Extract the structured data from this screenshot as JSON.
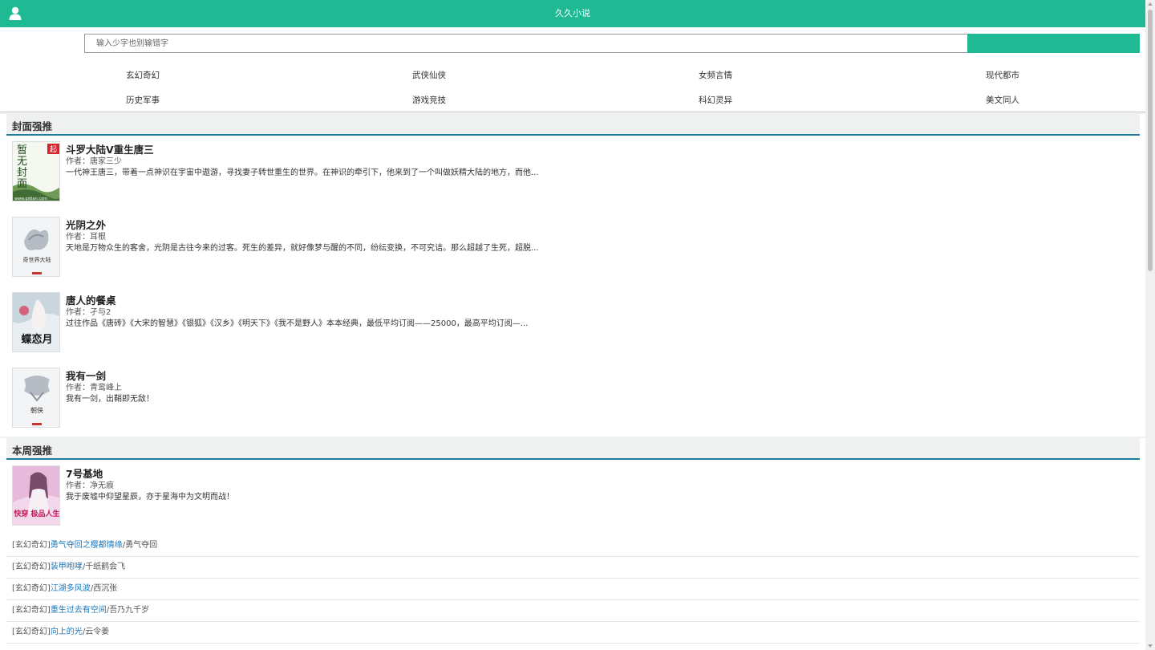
{
  "header": {
    "title": "久久小说",
    "icon": "user-icon"
  },
  "search": {
    "placeholder": "输入少字也别输错字"
  },
  "categories": [
    "玄幻奇幻",
    "武侠仙侠",
    "女频言情",
    "现代都市",
    "历史军事",
    "游戏竞技",
    "科幻灵异",
    "美文同人"
  ],
  "sections": {
    "cover": {
      "title": "封面强推"
    },
    "weekly": {
      "title": "本周强推"
    }
  },
  "cover_books": [
    {
      "name": "斗罗大陆V重生唐三",
      "author": "作者：唐家三少",
      "desc": "一代神王唐三，带着一点神识在宇宙中遨游，寻找妻子转世重生的世界。在神识的牵引下，他来到了一个叫做妖精大陆的地方，而他...",
      "cover_text": "暂无封面",
      "cover_badge": "起",
      "cover_url": "www.qidian.com"
    },
    {
      "name": "光阴之外",
      "author": "作者：耳根",
      "desc": "天地是万物众生的客舍，光阴是古往今来的过客。死生的差异，就好像梦与醒的不同，纷纭变换，不可究诘。那么超越了生死，超脱...",
      "cover_text": "奇世界大陆"
    },
    {
      "name": "唐人的餐桌",
      "author": "作者：孑与2",
      "desc": "过往作品《唐砖》《大宋的智慧》《银狐》《汉乡》《明天下》《我不是野人》本本经典，最低平均订阅——25000，最高平均订阅—...",
      "cover_text": "蝶恋月"
    },
    {
      "name": "我有一剑",
      "author": "作者：青鸾峰上",
      "desc": "我有一剑，出鞘即无敌！",
      "cover_text": "朝侠"
    }
  ],
  "weekly_book": {
    "name": "7号基地",
    "author": "作者：净无痕",
    "desc": "我于废墟中仰望星辰，亦于星海中为文明而战！",
    "cover_text": "快穿 极品人生"
  },
  "weekly_list": [
    {
      "genre": "[玄幻奇幻]",
      "book": "勇气夺回之樱都情缘",
      "sep": "/",
      "author": "勇气夺回"
    },
    {
      "genre": "[玄幻奇幻]",
      "book": "装甲咆哮",
      "sep": "/",
      "author": "千纸鹤会飞"
    },
    {
      "genre": "[玄幻奇幻]",
      "book": "江湖多风波",
      "sep": "/",
      "author": "西沉张"
    },
    {
      "genre": "[玄幻奇幻]",
      "book": "重生过去有空间",
      "sep": "/",
      "author": "吾乃九千岁"
    },
    {
      "genre": "[玄幻奇幻]",
      "book": "向上的光",
      "sep": "/",
      "author": "云令姜"
    }
  ],
  "colors": {
    "brand": "#1fb993",
    "section_underline": "#1e7b9a",
    "link": "#1a7abf"
  }
}
